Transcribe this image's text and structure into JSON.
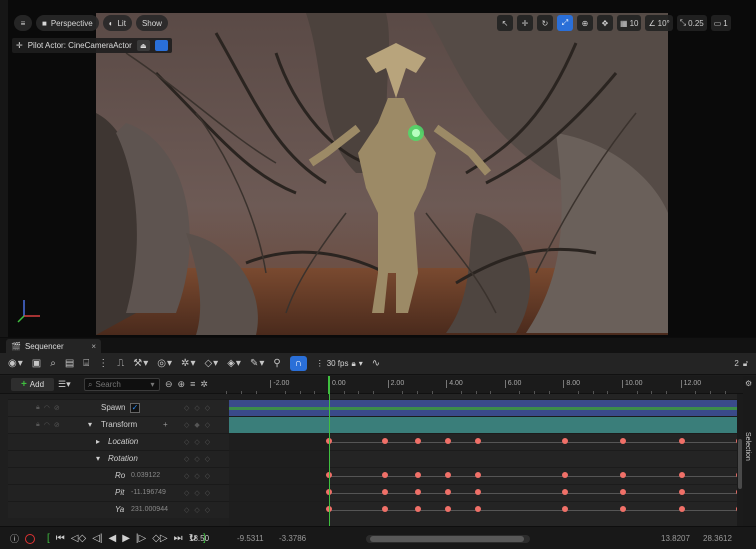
{
  "viewport": {
    "menu_icon": "hamburger-icon",
    "perspective_label": "Perspective",
    "lit_label": "Lit",
    "show_label": "Show",
    "grid_snap_value": "10",
    "rotation_snap_value": "10°",
    "scale_snap_value": "0.25",
    "camera_speed_value": "1",
    "pilot_label": "Pilot Actor: CineCameraActor"
  },
  "sequencer": {
    "tab_label": "Sequencer",
    "tab_close": "×",
    "fps_label": "30 fps",
    "toolbar_right_count": "2",
    "add_label": "Add",
    "search_placeholder": "Search",
    "selection_tab_label": "Selection",
    "ruler_ticks": [
      "-2.00",
      "0.00",
      "2.00",
      "4.00",
      "6.00",
      "8.00",
      "10.00",
      "12.00"
    ],
    "tracks": {
      "spawn_label": "Spawn",
      "transform_label": "Transform",
      "location_label": "Location",
      "rotation_label": "Rotation",
      "roll_label": "Ro",
      "roll_value": "0.039122",
      "pitch_label": "Pit",
      "pitch_value": "-11.196749",
      "yaw_label": "Ya",
      "yaw_value": "231.000944"
    },
    "transport": {
      "current_frame": "18.50",
      "view_start": "-9.5311",
      "play_start": "-3.3786",
      "play_end": "13.8207",
      "view_end": "28.3612"
    },
    "playhead_time": 0.0,
    "keyframe_times": [
      0.0,
      1.9,
      3.05,
      4.05,
      5.1,
      8.05,
      10.05,
      12.05,
      14.0,
      16.1
    ]
  },
  "colors": {
    "accent": "#2a6fd8",
    "playhead": "#3fbf3f",
    "keyframe": "#f07068",
    "spawn_track": "#4a5aa8",
    "transform_track": "#3d8a86"
  }
}
